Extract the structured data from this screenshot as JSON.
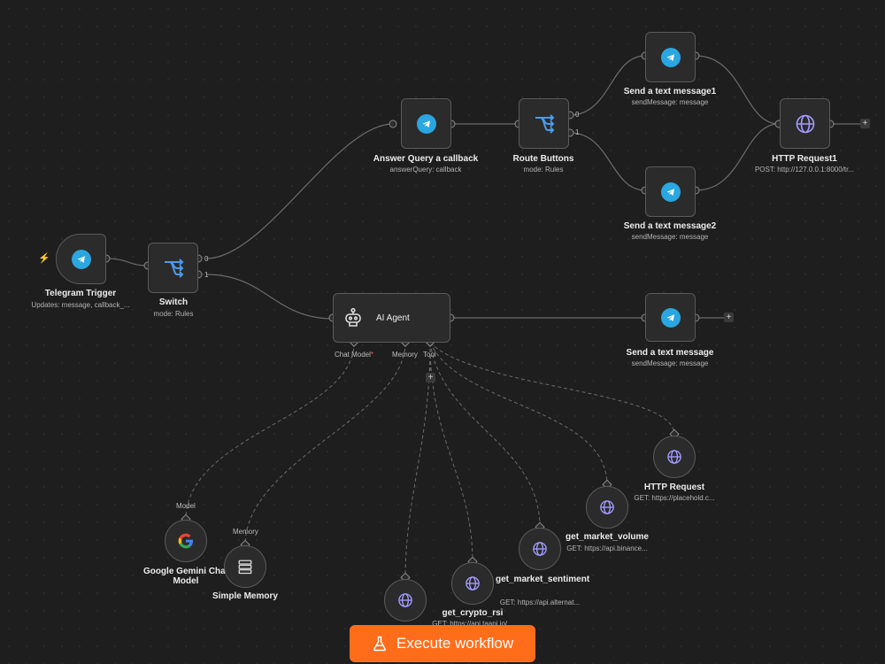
{
  "nodes": {
    "telegram_trigger": {
      "title": "Telegram Trigger",
      "subtitle": "Updates: message, callback_..."
    },
    "switch": {
      "title": "Switch",
      "subtitle": "mode: Rules",
      "output_0": "0",
      "output_1": "1"
    },
    "answer_query": {
      "title": "Answer Query a callback",
      "subtitle": "answerQuery: callback"
    },
    "route_buttons": {
      "title": "Route Buttons",
      "subtitle": "mode: Rules",
      "output_0": "0",
      "output_1": "1"
    },
    "send_text_1": {
      "title": "Send a text message1",
      "subtitle": "sendMessage: message"
    },
    "send_text_2": {
      "title": "Send a text message2",
      "subtitle": "sendMessage: message"
    },
    "http_request_1": {
      "title": "HTTP Request1",
      "subtitle": "POST: http://127.0.0.1:8000/tr..."
    },
    "ai_agent": {
      "title": "AI Agent",
      "port_chat_model": "Chat Model",
      "port_chat_model_required": "*",
      "port_memory": "Memory",
      "port_tool": "Tool"
    },
    "send_text": {
      "title": "Send a text message",
      "subtitle": "sendMessage: message"
    },
    "gemini": {
      "title": "Google Gemini Chat Model",
      "port_label": "Model"
    },
    "memory": {
      "title": "Simple Memory",
      "port_label": "Memory"
    },
    "crypto_rsi": {
      "title": "get_crypto_rsi",
      "subtitle": "GET: https://api.taapi.io/..."
    },
    "market_sentiment": {
      "title": "get_market_sentiment",
      "subtitle": "GET: https://api.alternat..."
    },
    "market_volume": {
      "title": "get_market_volume",
      "subtitle": "GET: https://api.binance..."
    },
    "http_request": {
      "title": "HTTP Request",
      "subtitle": "GET: https://placehold.c..."
    }
  },
  "toolbar": {
    "execute_label": "Execute workflow"
  },
  "icons": {
    "telegram": "telegram-icon",
    "switch": "switch-icon",
    "http": "globe-icon",
    "agent": "robot-icon",
    "gemini": "google-icon",
    "memory": "database-icon",
    "execute": "flask-icon",
    "trigger": "bolt-icon",
    "add": "plus-icon"
  },
  "colors": {
    "canvas": "#1e1e1e",
    "node_bg": "#2b2b2b",
    "node_border": "#5a5a5a",
    "telegram": "#2aa6e0",
    "accent": "#ff6d1b",
    "switch_icon": "#4d9be8",
    "http_icon": "#a39bff"
  }
}
